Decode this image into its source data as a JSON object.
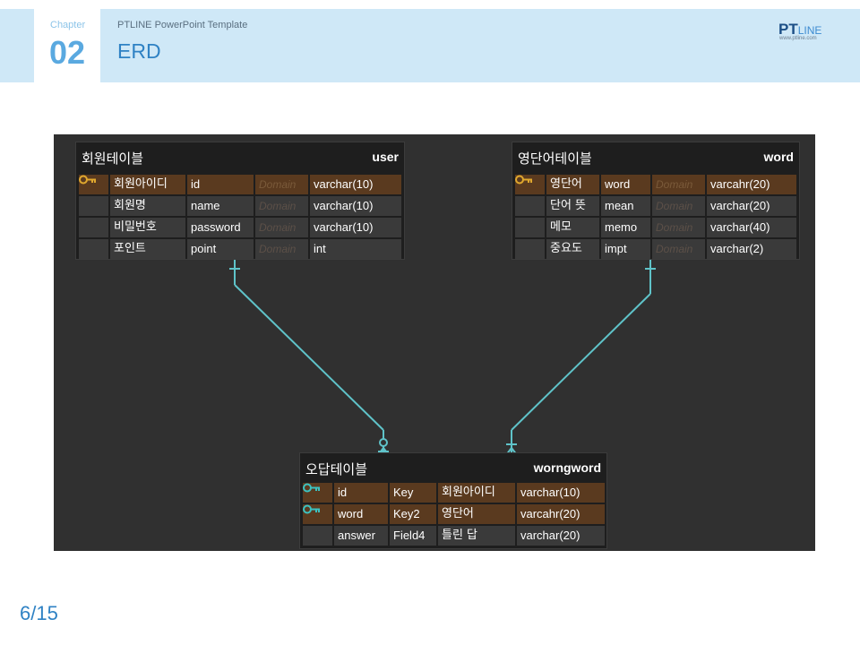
{
  "header": {
    "chapter_label": "Chapter",
    "chapter_num": "02",
    "template_name": "PTLINE PowerPoint Template",
    "title": "ERD",
    "logo_pt": "PT",
    "logo_line": "LINE",
    "logo_url": "www.ptline.com"
  },
  "colors": {
    "header_band": "#cfe8f7",
    "accent_blue": "#2f82c4",
    "canvas": "#303030",
    "pk_row": "#5a3a1f",
    "relation_line": "#5fc3c9",
    "key_gold": "#e0a82e",
    "key_teal": "#3cc2c0"
  },
  "tables": {
    "user": {
      "kor": "회원테이블",
      "eng": "user",
      "rows": [
        {
          "key": true,
          "c1": "회원아이디",
          "c2": "id",
          "c3": "Domain",
          "c4": "varchar(10)"
        },
        {
          "key": false,
          "c1": "회원명",
          "c2": "name",
          "c3": "Domain",
          "c4": "varchar(10)"
        },
        {
          "key": false,
          "c1": "비밀번호",
          "c2": "password",
          "c3": "Domain",
          "c4": "varchar(10)"
        },
        {
          "key": false,
          "c1": "포인트",
          "c2": "point",
          "c3": "Domain",
          "c4": "int"
        }
      ]
    },
    "word": {
      "kor": "영단어테이블",
      "eng": "word",
      "rows": [
        {
          "key": true,
          "c1": "영단어",
          "c2": "word",
          "c3": "Domain",
          "c4": "varcahr(20)"
        },
        {
          "key": false,
          "c1": "단어 뜻",
          "c2": "mean",
          "c3": "Domain",
          "c4": "varchar(20)"
        },
        {
          "key": false,
          "c1": "메모",
          "c2": "memo",
          "c3": "Domain",
          "c4": "varchar(40)"
        },
        {
          "key": false,
          "c1": "중요도",
          "c2": "impt",
          "c3": "Domain",
          "c4": "varchar(2)"
        }
      ]
    },
    "worngword": {
      "kor": "오답테이블",
      "eng": "worngword",
      "rows": [
        {
          "key": true,
          "c1": "id",
          "c2": "Key",
          "c3": "회원아이디",
          "c4": "varchar(10)"
        },
        {
          "key": true,
          "c1": "word",
          "c2": "Key2",
          "c3": "영단어",
          "c4": "varcahr(20)"
        },
        {
          "key": false,
          "c1": "answer",
          "c2": "Field4",
          "c3": "틀린 답",
          "c4": "varchar(20)"
        }
      ]
    }
  },
  "page": {
    "number": "6/15"
  }
}
